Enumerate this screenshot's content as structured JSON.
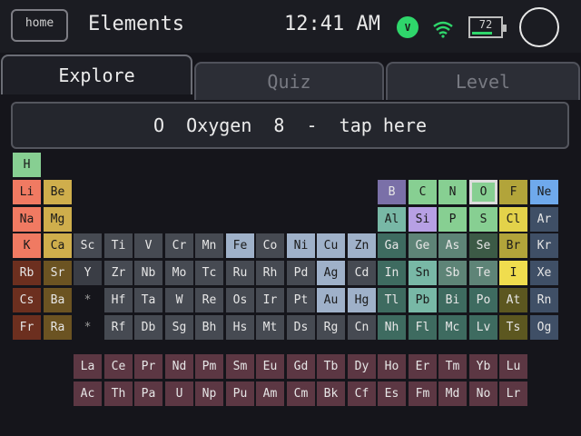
{
  "header": {
    "home_label": "home",
    "app_title": "Elements",
    "time": "12:41 AM",
    "badge_letter": "V",
    "battery_level": "72",
    "battery_fraction": 0.72
  },
  "tabs": [
    {
      "label": "Explore",
      "active": true
    },
    {
      "label": "Quiz",
      "active": false
    },
    {
      "label": "Level",
      "active": false
    }
  ],
  "banner": {
    "text": "O  Oxygen  8  -  tap here"
  },
  "colors": {
    "nonmetal": "#87cf92",
    "noble": "#6fa9ec",
    "alkali": "#f07a62",
    "alkaline": "#cfae4c",
    "transition": "#464a52",
    "post_transition": "#3e6b60",
    "metalloid": "#5e8477",
    "nonmetal_dark": "#3c5a46",
    "halogen_boron_b": "#7a70a8",
    "silicon": "#b7a0e4",
    "chlorine": "#e3d24a",
    "iodine": "#f0dd4e",
    "fluorine": "#b2a43a",
    "light_blue": "#9fb1c9",
    "lanthanide": "#5c3743",
    "dark_red": "#6c2f1f",
    "dark_yellow": "#6b5322",
    "accent_green": "#2fd66b"
  },
  "table_rows": [
    [
      [
        "H",
        "nonmetal",
        1
      ]
    ],
    [
      [
        "Li",
        "alkali",
        1
      ],
      [
        "Be",
        "alkaline",
        2
      ],
      [
        "B",
        "boron",
        13
      ],
      [
        "C",
        "nonmetal",
        14
      ],
      [
        "N",
        "nonmetal",
        15
      ],
      [
        "O",
        "oxygen",
        16
      ],
      [
        "F",
        "fluorine",
        17
      ],
      [
        "Ne",
        "noble",
        18
      ]
    ],
    [
      [
        "Na",
        "alkali",
        1
      ],
      [
        "Mg",
        "alkaline",
        2
      ],
      [
        "Al",
        "metalloid_light",
        13
      ],
      [
        "Si",
        "silicon",
        14
      ],
      [
        "P",
        "nonmetal",
        15
      ],
      [
        "S",
        "nonmetal",
        16
      ],
      [
        "Cl",
        "chlorine",
        17
      ],
      [
        "Ar",
        "noble_dark",
        18
      ]
    ],
    [
      [
        "K",
        "alkali",
        1
      ],
      [
        "Ca",
        "alkaline",
        2
      ],
      [
        "Sc",
        "transition",
        3
      ],
      [
        "Ti",
        "transition",
        4
      ],
      [
        "V",
        "transition",
        5
      ],
      [
        "Cr",
        "transition",
        6
      ],
      [
        "Mn",
        "transition",
        7
      ],
      [
        "Fe",
        "light_blue",
        8
      ],
      [
        "Co",
        "transition",
        9
      ],
      [
        "Ni",
        "light_blue",
        10
      ],
      [
        "Cu",
        "light_blue",
        11
      ],
      [
        "Zn",
        "light_blue",
        12
      ],
      [
        "Ga",
        "post",
        13
      ],
      [
        "Ge",
        "metalloid_dark",
        14
      ],
      [
        "As",
        "metalloid_dark",
        15
      ],
      [
        "Se",
        "nonmetal_dark",
        16
      ],
      [
        "Br",
        "fluorine",
        17
      ],
      [
        "Kr",
        "noble_dark",
        18
      ]
    ],
    [
      [
        "Rb",
        "dark_red",
        1
      ],
      [
        "Sr",
        "dark_yellow",
        2
      ],
      [
        "Y",
        "transition_dark",
        3
      ],
      [
        "Zr",
        "transition",
        4
      ],
      [
        "Nb",
        "transition",
        5
      ],
      [
        "Mo",
        "transition",
        6
      ],
      [
        "Tc",
        "transition",
        7
      ],
      [
        "Ru",
        "transition",
        8
      ],
      [
        "Rh",
        "transition",
        9
      ],
      [
        "Pd",
        "transition",
        10
      ],
      [
        "Ag",
        "light_blue",
        11
      ],
      [
        "Cd",
        "transition",
        12
      ],
      [
        "In",
        "post",
        13
      ],
      [
        "Sn",
        "metalloid_light",
        14
      ],
      [
        "Sb",
        "metalloid_dark",
        15
      ],
      [
        "Te",
        "metalloid_dark",
        16
      ],
      [
        "I",
        "iodine",
        17
      ],
      [
        "Xe",
        "noble_dark",
        18
      ]
    ],
    [
      [
        "Cs",
        "dark_red",
        1
      ],
      [
        "Ba",
        "dark_yellow",
        2
      ],
      [
        "*",
        "star",
        3
      ],
      [
        "Hf",
        "transition",
        4
      ],
      [
        "Ta",
        "transition",
        5
      ],
      [
        "W",
        "transition",
        6
      ],
      [
        "Re",
        "transition",
        7
      ],
      [
        "Os",
        "transition",
        8
      ],
      [
        "Ir",
        "transition",
        9
      ],
      [
        "Pt",
        "transition",
        10
      ],
      [
        "Au",
        "light_blue",
        11
      ],
      [
        "Hg",
        "light_blue",
        12
      ],
      [
        "Tl",
        "post",
        13
      ],
      [
        "Pb",
        "metalloid_light",
        14
      ],
      [
        "Bi",
        "post",
        15
      ],
      [
        "Po",
        "post",
        16
      ],
      [
        "At",
        "dark_olive",
        17
      ],
      [
        "Rn",
        "noble_dark",
        18
      ]
    ],
    [
      [
        "Fr",
        "dark_red",
        1
      ],
      [
        "Ra",
        "dark_yellow",
        2
      ],
      [
        "*",
        "star",
        3
      ],
      [
        "Rf",
        "transition",
        4
      ],
      [
        "Db",
        "transition",
        5
      ],
      [
        "Sg",
        "transition",
        6
      ],
      [
        "Bh",
        "transition",
        7
      ],
      [
        "Hs",
        "transition",
        8
      ],
      [
        "Mt",
        "transition",
        9
      ],
      [
        "Ds",
        "transition",
        10
      ],
      [
        "Rg",
        "transition",
        11
      ],
      [
        "Cn",
        "transition",
        12
      ],
      [
        "Nh",
        "post",
        13
      ],
      [
        "Fl",
        "post",
        14
      ],
      [
        "Mc",
        "post",
        15
      ],
      [
        "Lv",
        "post",
        16
      ],
      [
        "Ts",
        "dark_olive",
        17
      ],
      [
        "Og",
        "noble_dark",
        18
      ]
    ]
  ],
  "f_block": [
    [
      "La",
      "Ce",
      "Pr",
      "Nd",
      "Pm",
      "Sm",
      "Eu",
      "Gd",
      "Tb",
      "Dy",
      "Ho",
      "Er",
      "Tm",
      "Yb",
      "Lu"
    ],
    [
      "Ac",
      "Th",
      "Pa",
      "U",
      "Np",
      "Pu",
      "Am",
      "Cm",
      "Bk",
      "Cf",
      "Es",
      "Fm",
      "Md",
      "No",
      "Lr"
    ]
  ],
  "selected_element": "O"
}
